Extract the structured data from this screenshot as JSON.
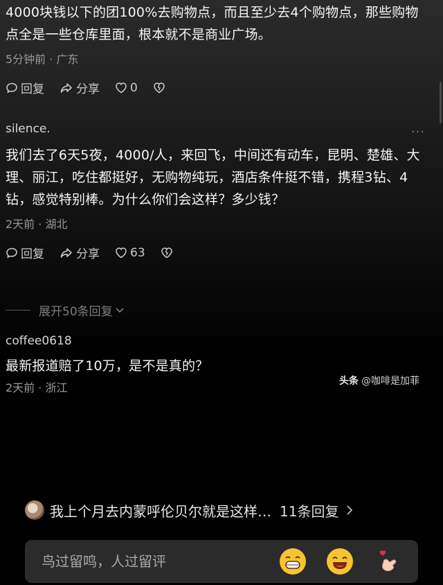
{
  "comments": [
    {
      "body": "4000块钱以下的团100%去购物点，而且至少去4个购物点，那些购物点全是一些仓库里面，根本就不是商业广场。",
      "meta": "5分钟前 · 广东",
      "reply_label": "回复",
      "share_label": "分享",
      "likes": "0"
    },
    {
      "user": "silence.",
      "body": "我们去了6天5夜，4000/人，来回飞，中间还有动车，昆明、楚雄、大理、丽江，吃住都挺好，无购物纯玩，酒店条件挺不错，携程3钻、4钻，感觉特别棒。为什么你们会这样？多少钱？",
      "meta": "2天前 · 湖北",
      "reply_label": "回复",
      "share_label": "分享",
      "likes": "63",
      "more": "···"
    },
    {
      "user": "coffee0618",
      "body": "最新报道赔了10万，是不是真的？",
      "meta": "2天前 · 浙江"
    }
  ],
  "expand_label": "展开50条回复",
  "watermark": {
    "brand": "头条",
    "handle": "@咖啡是加菲"
  },
  "reply_bar": {
    "text": "我上个月去内蒙呼伦贝尔就是这样…",
    "count": "11条回复"
  },
  "input": {
    "placeholder": "鸟过留鸣，人过留评"
  },
  "colors": {
    "background": "#000000",
    "text": "#f2f2f2",
    "meta": "#9a9a9a",
    "input_bg": "#2b2b2b",
    "emoji": "#f6c430"
  }
}
